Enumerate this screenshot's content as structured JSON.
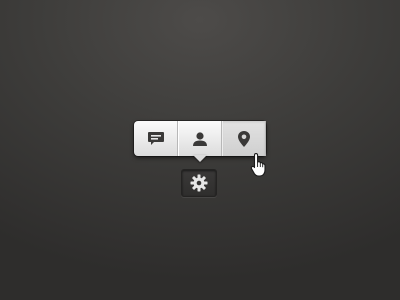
{
  "popover": {
    "items": [
      {
        "id": "comment",
        "icon": "comment-icon",
        "active": false
      },
      {
        "id": "user",
        "icon": "user-icon",
        "active": false
      },
      {
        "id": "location",
        "icon": "location-pin-icon",
        "active": true
      }
    ]
  },
  "settings_button": {
    "icon": "gear-icon"
  },
  "pointer": {
    "icon": "hand-cursor-icon"
  },
  "colors": {
    "icon": "#3a3938",
    "popover_light": "#fbfbfb",
    "popover_dark": "#dcdcdc",
    "background": "#3e3d3b"
  }
}
